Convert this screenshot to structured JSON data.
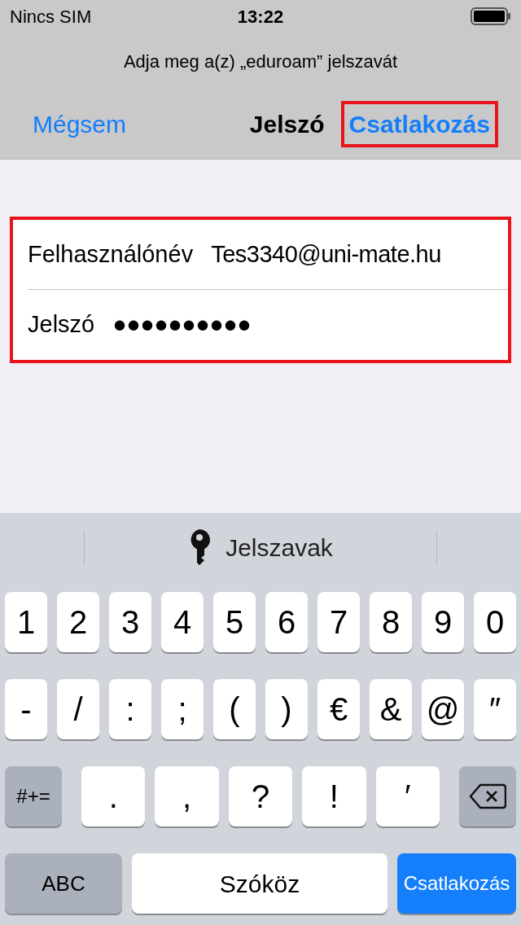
{
  "status_bar": {
    "carrier": "Nincs SIM",
    "time": "13:22"
  },
  "prompt": "Adja meg a(z) „eduroam” jelszavát",
  "nav": {
    "cancel": "Mégsem",
    "title": "Jelszó",
    "join": {
      "label": "Csatlakozás",
      "highlighted": true
    }
  },
  "form": {
    "highlighted": true,
    "fields": [
      {
        "label": "Felhasználónév",
        "value": "Tes3340@uni-mate.hu"
      },
      {
        "label": "Jelszó",
        "value": "●●●●●●●●●●"
      }
    ]
  },
  "suggestion_bar": {
    "label": "Jelszavak"
  },
  "keyboard": {
    "rows": [
      {
        "keys": [
          {
            "kind": "char",
            "label": "1"
          },
          {
            "kind": "char",
            "label": "2"
          },
          {
            "kind": "char",
            "label": "3"
          },
          {
            "kind": "char",
            "label": "4"
          },
          {
            "kind": "char",
            "label": "5"
          },
          {
            "kind": "char",
            "label": "6"
          },
          {
            "kind": "char",
            "label": "7"
          },
          {
            "kind": "char",
            "label": "8"
          },
          {
            "kind": "char",
            "label": "9"
          },
          {
            "kind": "char",
            "label": "0"
          }
        ]
      },
      {
        "keys": [
          {
            "kind": "char",
            "label": "-"
          },
          {
            "kind": "char",
            "label": "/"
          },
          {
            "kind": "char",
            "label": ":"
          },
          {
            "kind": "char",
            "label": ";"
          },
          {
            "kind": "char",
            "label": "("
          },
          {
            "kind": "char",
            "label": ")"
          },
          {
            "kind": "char",
            "label": "€"
          },
          {
            "kind": "char",
            "label": "&"
          },
          {
            "kind": "char",
            "label": "@"
          },
          {
            "kind": "char",
            "label": "″"
          }
        ]
      },
      {
        "keys": [
          {
            "kind": "mod",
            "label": "#+="
          },
          {
            "kind": "char",
            "label": "."
          },
          {
            "kind": "char",
            "label": ","
          },
          {
            "kind": "char",
            "label": "?"
          },
          {
            "kind": "char",
            "label": "!"
          },
          {
            "kind": "char",
            "label": "′"
          },
          {
            "kind": "delete"
          }
        ]
      },
      {
        "keys": [
          {
            "kind": "abc",
            "label": "ABC"
          },
          {
            "kind": "space",
            "label": "Szóköz"
          },
          {
            "kind": "action",
            "label": "Csatlakozás"
          }
        ]
      }
    ]
  }
}
